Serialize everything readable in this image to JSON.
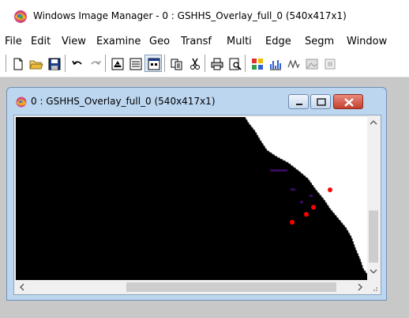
{
  "app": {
    "title": "Windows Image Manager - 0 : GSHHS_Overlay_full_0 (540x417x1)"
  },
  "menu": {
    "items": [
      "File",
      "Edit",
      "View",
      "Examine",
      "Geo",
      "Transf",
      "Multi",
      "Edge",
      "Segm",
      "Window"
    ]
  },
  "toolbar": {
    "icons": [
      "new-file-icon",
      "open-folder-icon",
      "save-disk-icon",
      "undo-icon",
      "redo-icon",
      "display-icon",
      "list-icon",
      "image-view-icon",
      "copy-icon",
      "cut-icon",
      "print-icon",
      "print-preview-icon",
      "color-palette-icon",
      "histogram-icon",
      "signal-icon",
      "image-icon",
      "export-icon"
    ]
  },
  "child_window": {
    "title": "0 : GSHHS_Overlay_full_0 (540x417x1)"
  },
  "colors": {
    "canvas": "#000000",
    "land": "#ffffff",
    "overlay_points": "#ff0000",
    "overlay_text": "#3a0a5a",
    "title_bar": "#bcd6ef",
    "close_button": "#c2402e"
  }
}
